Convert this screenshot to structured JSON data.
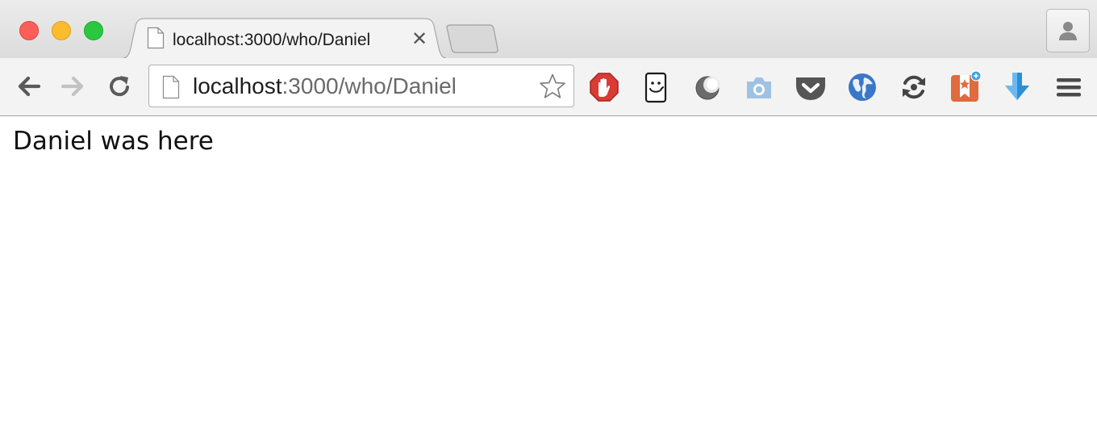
{
  "window": {
    "traffic_lights": {
      "close": "#fc5f57",
      "minimize": "#fdbc2e",
      "maximize": "#29c840"
    }
  },
  "tabs": [
    {
      "title": "localhost:3000/who/Daniel",
      "active": true,
      "close_label": "✕",
      "icon": "page-icon"
    }
  ],
  "toolbar": {
    "back_icon": "arrow-left-icon",
    "forward_icon": "arrow-right-icon",
    "reload_icon": "reload-icon",
    "omnibox": {
      "url_host": "localhost",
      "url_rest": ":3000/who/Daniel",
      "page_icon": "page-icon",
      "bookmark_icon": "star-icon"
    },
    "extensions": [
      {
        "name": "adblock-icon",
        "color": "#d93b35"
      },
      {
        "name": "smiley-phone-icon",
        "color": "#1a1a1a"
      },
      {
        "name": "moon-icon",
        "color": "#6b6b6b"
      },
      {
        "name": "camera-icon",
        "color": "#9fc2e2"
      },
      {
        "name": "pocket-icon",
        "color": "#555555"
      },
      {
        "name": "globe-icon",
        "color": "#3b77c9"
      },
      {
        "name": "sync-icon",
        "color": "#444444"
      },
      {
        "name": "bookmark-star-icon",
        "color": "#e06b3c"
      },
      {
        "name": "download-arrow-icon",
        "color": "#2b8fd6"
      }
    ],
    "menu_icon": "hamburger-menu-icon",
    "profile_icon": "person-icon"
  },
  "page": {
    "text": "Daniel was here"
  }
}
